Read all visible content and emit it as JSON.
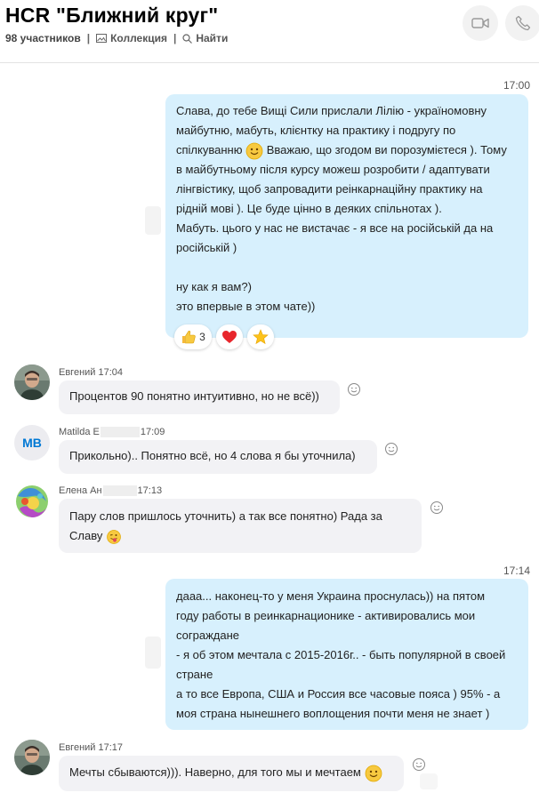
{
  "header": {
    "title": "HCR \"Ближний круг\"",
    "members": "98 участников",
    "collection_label": "Коллекция",
    "search_label": "Найти",
    "separator": "|"
  },
  "messages": {
    "m1": {
      "time": "17:00",
      "lines": [
        "Слава, до тебе Вищі Сили прислали Лілію - україномовну",
        "майбутню, мабуть, клієнтку на практику і подругу по",
        "спілкуванню",
        " Вважаю, що згодом ви порозумієтеся ). Тому",
        "в майбутньому після курсу можеш розробити / адаптувати",
        "лінгвістику, щоб  запровадити реінкарнаційну практику на",
        "рідній мові ). Це буде цінно в деяких спільнотах ).",
        "Мабуть. цього у нас не вистачає - я все на російській да на",
        "російській )",
        "ну как я вам?)",
        "это впервые в этом чате))"
      ],
      "reactions": [
        {
          "emoji": "thumbs-up-icon",
          "count": "3"
        },
        {
          "emoji": "heart-icon"
        },
        {
          "emoji": "star-icon"
        }
      ]
    },
    "m2": {
      "sender": "Евгений",
      "time": "17:04",
      "text": "Процентов 90 понятно интуитивно, но не всё))"
    },
    "m3": {
      "avatar_initials": "MB",
      "sender": "Matilda E",
      "time": "17:09",
      "text": "Прикольно).. Понятно всё, но 4 слова я бы уточнила)"
    },
    "m4": {
      "sender": "Елена Ан",
      "time": "17:13",
      "lines": [
        "Пару слов пришлось уточнить) а так все понятно) Рада за",
        "Славу"
      ]
    },
    "m5": {
      "time": "17:14",
      "lines": [
        "дааа... наконец-то у меня Украина проснулась)) на пятом",
        "году работы в реинкарнационике - активировались мои",
        "сограждане",
        "- я об этом мечтала с 2015-2016г.. - быть популярной в своей",
        "стране",
        "а то все Европа, США и Россия все часовые пояса ) 95% - а",
        "моя страна нынешнего воплощения почти меня не знает )"
      ]
    },
    "m6": {
      "sender": "Евгений",
      "time": "17:17",
      "text": "Мечты сбываются))). Наверно, для того мы и мечтаем"
    }
  },
  "colors": {
    "outgoing_bubble": "#d7f0fd",
    "incoming_bubble": "#f2f2f5",
    "avatar_initials_color": "#0078d4"
  }
}
